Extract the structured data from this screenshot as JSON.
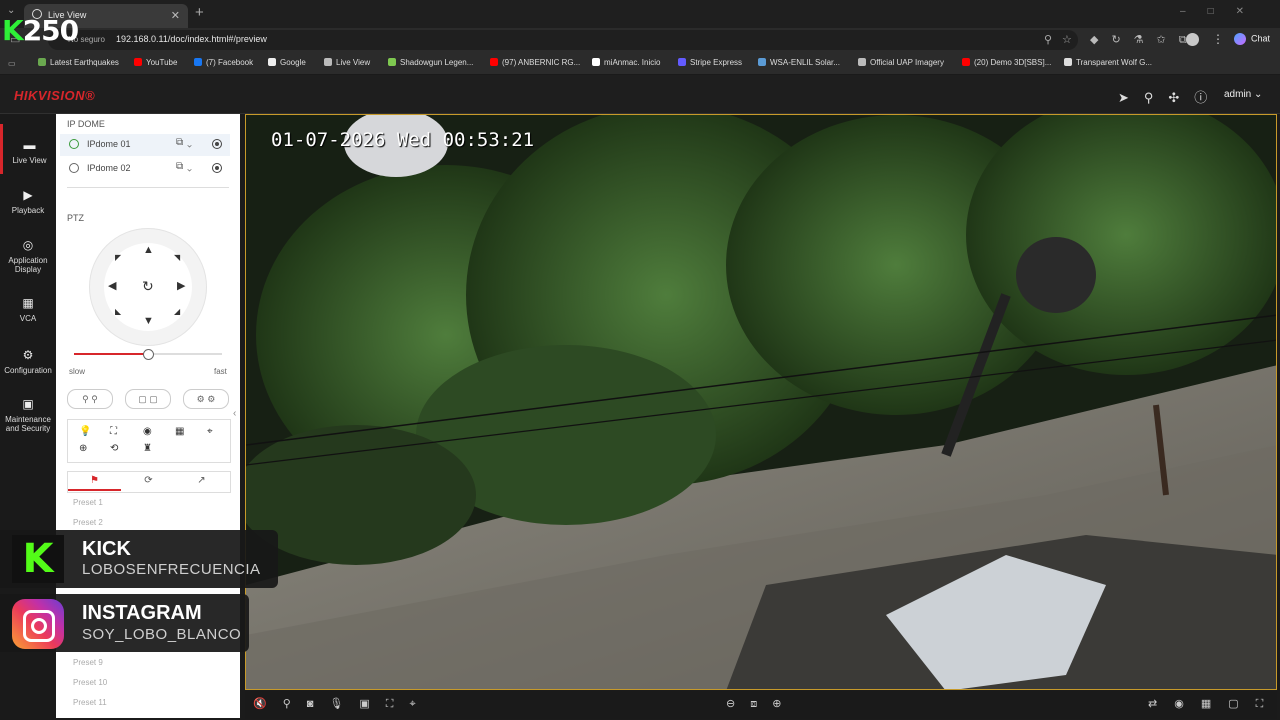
{
  "browser": {
    "tab_title": "Live View",
    "security_label": "No seguro",
    "url": "192.168.0.11/doc/index.html#/preview",
    "chat_label": "Chat",
    "bookmarks": [
      {
        "label": "Latest Earthquakes",
        "color": "#6aa84f"
      },
      {
        "label": "YouTube",
        "color": "#ff0000"
      },
      {
        "label": "(7) Facebook",
        "color": "#1877f2"
      },
      {
        "label": "Google",
        "color": "#eeeeee"
      },
      {
        "label": "Live View",
        "color": "#bbbbbb"
      },
      {
        "label": "Shadowgun Legen...",
        "color": "#7ec850"
      },
      {
        "label": "(97) ANBERNIC RG...",
        "color": "#ff0000"
      },
      {
        "label": "miAnmac. Inicio",
        "color": "#ffffff"
      },
      {
        "label": "Stripe Express",
        "color": "#635bff"
      },
      {
        "label": "WSA-ENLIL Solar...",
        "color": "#5b9bd5"
      },
      {
        "label": "Official UAP Imagery",
        "color": "#bbbbbb"
      },
      {
        "label": "(20) Demo 3D[SBS]...",
        "color": "#ff0000"
      },
      {
        "label": "Transparent Wolf G...",
        "color": "#dddddd"
      }
    ]
  },
  "overlay": {
    "logo_prefix": "K",
    "logo_number": "250"
  },
  "header": {
    "brand": "HIKVISION®",
    "user": "admin"
  },
  "nav": [
    {
      "label": "Live View",
      "icon": "▬"
    },
    {
      "label": "Playback",
      "icon": "▶"
    },
    {
      "label": "Application Display",
      "icon": "◎"
    },
    {
      "label": "VCA",
      "icon": "▦"
    },
    {
      "label": "Configuration",
      "icon": "⚙"
    },
    {
      "label": "Maintenance and Security",
      "icon": "▣"
    }
  ],
  "panel": {
    "group_label": "IP DOME",
    "cameras": [
      "IPdome 01",
      "IPdome 02"
    ],
    "ptz_label": "PTZ",
    "speed_min_label": "slow",
    "speed_max_label": "fast",
    "speed_level": 0.5,
    "presets": [
      "Preset 1",
      "Preset 2",
      "Preset 9",
      "Preset 10",
      "Preset 11"
    ]
  },
  "video": {
    "osd_timestamp": "01-07-2026 Wed 00:53:21"
  },
  "social": {
    "kick_title": "KICK",
    "kick_handle": "LOBOSENFRECUENCIA",
    "insta_title": "INSTAGRAM",
    "insta_handle": "SOY_LOBO_BLANCO"
  }
}
